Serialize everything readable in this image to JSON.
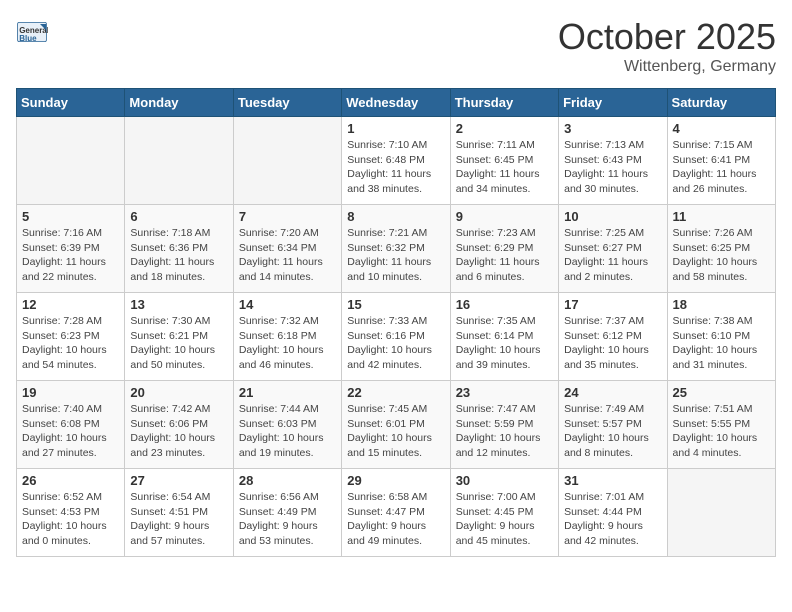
{
  "logo": {
    "general": "General",
    "blue": "Blue"
  },
  "title": "October 2025",
  "subtitle": "Wittenberg, Germany",
  "days_of_week": [
    "Sunday",
    "Monday",
    "Tuesday",
    "Wednesday",
    "Thursday",
    "Friday",
    "Saturday"
  ],
  "weeks": [
    [
      {
        "day": "",
        "info": ""
      },
      {
        "day": "",
        "info": ""
      },
      {
        "day": "",
        "info": ""
      },
      {
        "day": "1",
        "info": "Sunrise: 7:10 AM\nSunset: 6:48 PM\nDaylight: 11 hours\nand 38 minutes."
      },
      {
        "day": "2",
        "info": "Sunrise: 7:11 AM\nSunset: 6:45 PM\nDaylight: 11 hours\nand 34 minutes."
      },
      {
        "day": "3",
        "info": "Sunrise: 7:13 AM\nSunset: 6:43 PM\nDaylight: 11 hours\nand 30 minutes."
      },
      {
        "day": "4",
        "info": "Sunrise: 7:15 AM\nSunset: 6:41 PM\nDaylight: 11 hours\nand 26 minutes."
      }
    ],
    [
      {
        "day": "5",
        "info": "Sunrise: 7:16 AM\nSunset: 6:39 PM\nDaylight: 11 hours\nand 22 minutes."
      },
      {
        "day": "6",
        "info": "Sunrise: 7:18 AM\nSunset: 6:36 PM\nDaylight: 11 hours\nand 18 minutes."
      },
      {
        "day": "7",
        "info": "Sunrise: 7:20 AM\nSunset: 6:34 PM\nDaylight: 11 hours\nand 14 minutes."
      },
      {
        "day": "8",
        "info": "Sunrise: 7:21 AM\nSunset: 6:32 PM\nDaylight: 11 hours\nand 10 minutes."
      },
      {
        "day": "9",
        "info": "Sunrise: 7:23 AM\nSunset: 6:29 PM\nDaylight: 11 hours\nand 6 minutes."
      },
      {
        "day": "10",
        "info": "Sunrise: 7:25 AM\nSunset: 6:27 PM\nDaylight: 11 hours\nand 2 minutes."
      },
      {
        "day": "11",
        "info": "Sunrise: 7:26 AM\nSunset: 6:25 PM\nDaylight: 10 hours\nand 58 minutes."
      }
    ],
    [
      {
        "day": "12",
        "info": "Sunrise: 7:28 AM\nSunset: 6:23 PM\nDaylight: 10 hours\nand 54 minutes."
      },
      {
        "day": "13",
        "info": "Sunrise: 7:30 AM\nSunset: 6:21 PM\nDaylight: 10 hours\nand 50 minutes."
      },
      {
        "day": "14",
        "info": "Sunrise: 7:32 AM\nSunset: 6:18 PM\nDaylight: 10 hours\nand 46 minutes."
      },
      {
        "day": "15",
        "info": "Sunrise: 7:33 AM\nSunset: 6:16 PM\nDaylight: 10 hours\nand 42 minutes."
      },
      {
        "day": "16",
        "info": "Sunrise: 7:35 AM\nSunset: 6:14 PM\nDaylight: 10 hours\nand 39 minutes."
      },
      {
        "day": "17",
        "info": "Sunrise: 7:37 AM\nSunset: 6:12 PM\nDaylight: 10 hours\nand 35 minutes."
      },
      {
        "day": "18",
        "info": "Sunrise: 7:38 AM\nSunset: 6:10 PM\nDaylight: 10 hours\nand 31 minutes."
      }
    ],
    [
      {
        "day": "19",
        "info": "Sunrise: 7:40 AM\nSunset: 6:08 PM\nDaylight: 10 hours\nand 27 minutes."
      },
      {
        "day": "20",
        "info": "Sunrise: 7:42 AM\nSunset: 6:06 PM\nDaylight: 10 hours\nand 23 minutes."
      },
      {
        "day": "21",
        "info": "Sunrise: 7:44 AM\nSunset: 6:03 PM\nDaylight: 10 hours\nand 19 minutes."
      },
      {
        "day": "22",
        "info": "Sunrise: 7:45 AM\nSunset: 6:01 PM\nDaylight: 10 hours\nand 15 minutes."
      },
      {
        "day": "23",
        "info": "Sunrise: 7:47 AM\nSunset: 5:59 PM\nDaylight: 10 hours\nand 12 minutes."
      },
      {
        "day": "24",
        "info": "Sunrise: 7:49 AM\nSunset: 5:57 PM\nDaylight: 10 hours\nand 8 minutes."
      },
      {
        "day": "25",
        "info": "Sunrise: 7:51 AM\nSunset: 5:55 PM\nDaylight: 10 hours\nand 4 minutes."
      }
    ],
    [
      {
        "day": "26",
        "info": "Sunrise: 6:52 AM\nSunset: 4:53 PM\nDaylight: 10 hours\nand 0 minutes."
      },
      {
        "day": "27",
        "info": "Sunrise: 6:54 AM\nSunset: 4:51 PM\nDaylight: 9 hours\nand 57 minutes."
      },
      {
        "day": "28",
        "info": "Sunrise: 6:56 AM\nSunset: 4:49 PM\nDaylight: 9 hours\nand 53 minutes."
      },
      {
        "day": "29",
        "info": "Sunrise: 6:58 AM\nSunset: 4:47 PM\nDaylight: 9 hours\nand 49 minutes."
      },
      {
        "day": "30",
        "info": "Sunrise: 7:00 AM\nSunset: 4:45 PM\nDaylight: 9 hours\nand 45 minutes."
      },
      {
        "day": "31",
        "info": "Sunrise: 7:01 AM\nSunset: 4:44 PM\nDaylight: 9 hours\nand 42 minutes."
      },
      {
        "day": "",
        "info": ""
      }
    ]
  ]
}
